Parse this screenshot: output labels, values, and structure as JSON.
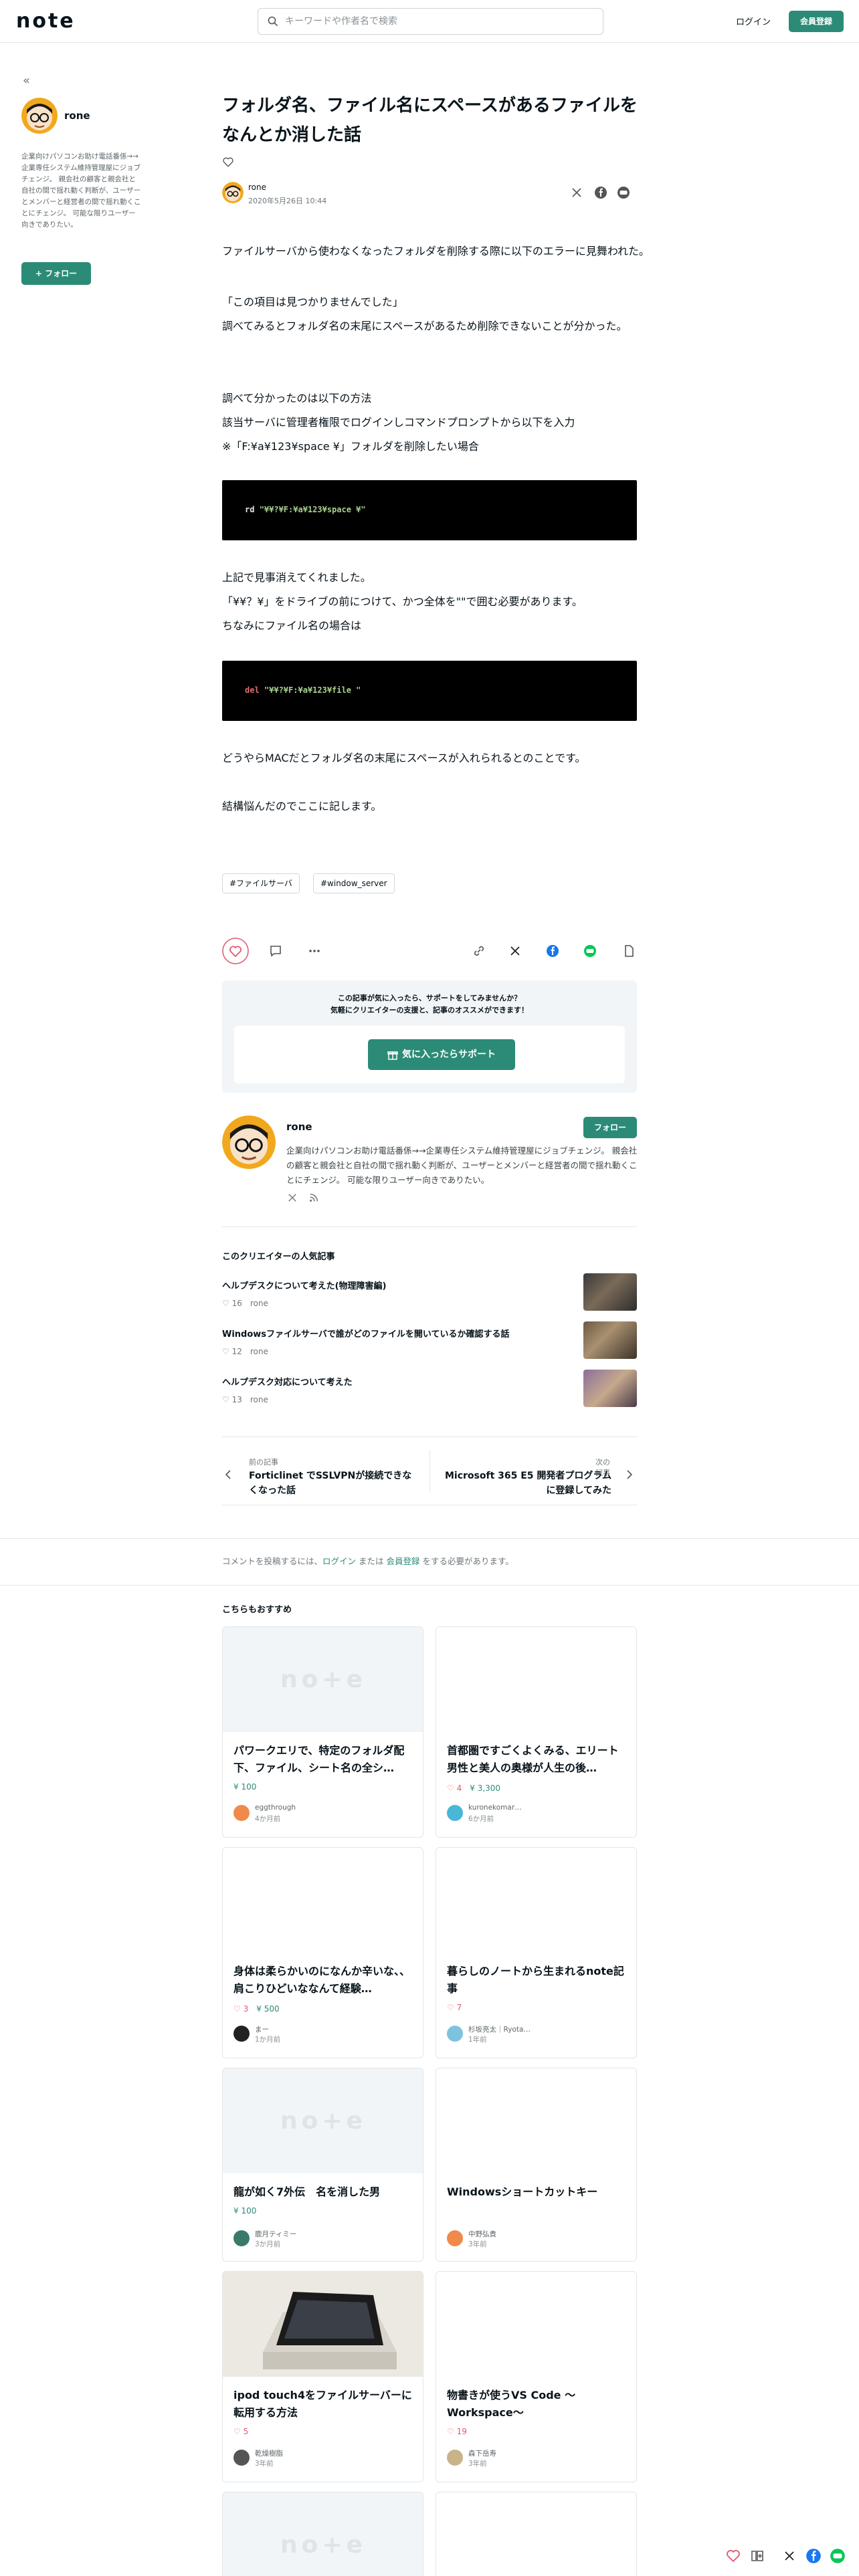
{
  "header": {
    "logo": "note",
    "search_placeholder": "キーワードや作者名で検索",
    "login": "ログイン",
    "signup": "会員登録"
  },
  "sidebar": {
    "name": "rone",
    "bio": "企業向けパソコンお助け電話番係→→企業専任システム維持管理屋にジョブチェンジ。 親会社の顧客と親会社と自社の間で揺れ動く判断が、ユーザーとメンバーと経営者の間で揺れ動くことにチェンジ。 可能な限りユーザー向きでありたい。",
    "follow": "+ フォロー"
  },
  "article": {
    "title": "フォルダ名、ファイル名にスペースがあるファイルをなんとか消した話",
    "author": "rone",
    "date": "2020年5月26日 10:44",
    "p1": "ファイルサーバから使わなくなったフォルダを削除する際に以下のエラーに見舞われた。",
    "p2": "「この項目は見つかりませんでした」",
    "p3": "調べてみるとフォルダ名の末尾にスペースがあるため削除できないことが分かった。",
    "p4": "調べて分かったのは以下の方法",
    "p5": "該当サーバに管理者権限でログインしコマンドプロンプトから以下を入力",
    "p6": "※「F:¥a¥123¥space ¥」フォルダを削除したい場合",
    "code1_kw": "rd ",
    "code1_str": "\"¥¥?¥F:¥a¥123¥space ¥\"",
    "p7": "上記で見事消えてくれました。",
    "p8": "「¥¥？¥」をドライブの前につけて、かつ全体を\"\"で囲む必要があります。",
    "p9": "ちなみにファイル名の場合は",
    "code2_kw": "del ",
    "code2_str": "\"¥¥?¥F:¥a¥123¥file \"",
    "p10": "どうやらMACだとフォルダ名の末尾にスペースが入れられるとのことです。",
    "p11": "結構悩んだのでここに記します。",
    "tags": [
      "#ファイルサーバ",
      "#window_server"
    ]
  },
  "support": {
    "line1": "この記事が気に入ったら、サポートをしてみませんか？",
    "line2": "気軽にクリエイターの支援と、記事のオススメができます！",
    "button": "気に入ったらサポート"
  },
  "author_card": {
    "name": "rone",
    "follow": "フォロー",
    "bio": "企業向けパソコンお助け電話番係→→企業専任システム維持管理屋にジョブチェンジ。 親会社の顧客と親会社と自社の間で揺れ動く判断が、ユーザーとメンバーと経営者の間で揺れ動くことにチェンジ。 可能な限りユーザー向きでありたい。"
  },
  "popular": {
    "heading": "このクリエイターの人気記事",
    "items": [
      {
        "title": "ヘルプデスクについて考えた(物理障害編)",
        "likes": "16",
        "author": "rone"
      },
      {
        "title": "Windowsファイルサーバで誰がどのファイルを開いているか確認する話",
        "likes": "12",
        "author": "rone"
      },
      {
        "title": "ヘルプデスク対応について考えた",
        "likes": "13",
        "author": "rone"
      }
    ]
  },
  "prevnext": {
    "prev_label": "前の記事",
    "prev_title": "Forticlinet でSSLVPNが接続できなくなった話",
    "next_label": "次の記事",
    "next_title": "Microsoft 365 E5 開発者プログラムに登録してみた"
  },
  "comment": {
    "before": "コメントを投稿するには、",
    "login": "ログイン",
    "mid": " または ",
    "signup": "会員登録",
    "after": " をする必要があります。"
  },
  "recommend": {
    "heading": "こちらもおすすめ",
    "cards": [
      {
        "title": "パワークエリで、特定のフォルダ配下、ファイル、シート名の全シ…",
        "likes": "",
        "yen": "100",
        "user": "eggthrough",
        "time": "4か月前"
      },
      {
        "title": "首都圏ですごくよくみる、エリート男性と美人の奥様が人生の後…",
        "likes": "4",
        "yen": "3,300",
        "user": "kuronekomar…",
        "time": "6か月前"
      },
      {
        "title": "身体は柔らかいのになんか辛いな、、肩こりひどいななんて経験…",
        "likes": "3",
        "yen": "500",
        "user": "まー",
        "time": "1か月前"
      },
      {
        "title": "暮らしのノートから生まれるnote記事",
        "likes": "7",
        "yen": "",
        "user": "杉坂亮太｜Ryota…",
        "time": "1年前"
      },
      {
        "title": "龍が如く7外伝　名を消した男",
        "likes": "",
        "yen": "100",
        "user": "鹿月ティミー",
        "time": "3か月前"
      },
      {
        "title": "Windowsショートカットキー",
        "likes": "",
        "yen": "",
        "user": "中野弘貴",
        "time": "3年前"
      },
      {
        "title": "ipod touch4をファイルサーバーに転用する方法",
        "likes": "5",
        "yen": "",
        "user": "乾燥樹脂",
        "time": "3年前"
      },
      {
        "title": "物書きが使うVS Code 〜Workspace〜",
        "likes": "19",
        "yen": "",
        "user": "森下岳寿",
        "time": "3年前"
      }
    ]
  }
}
